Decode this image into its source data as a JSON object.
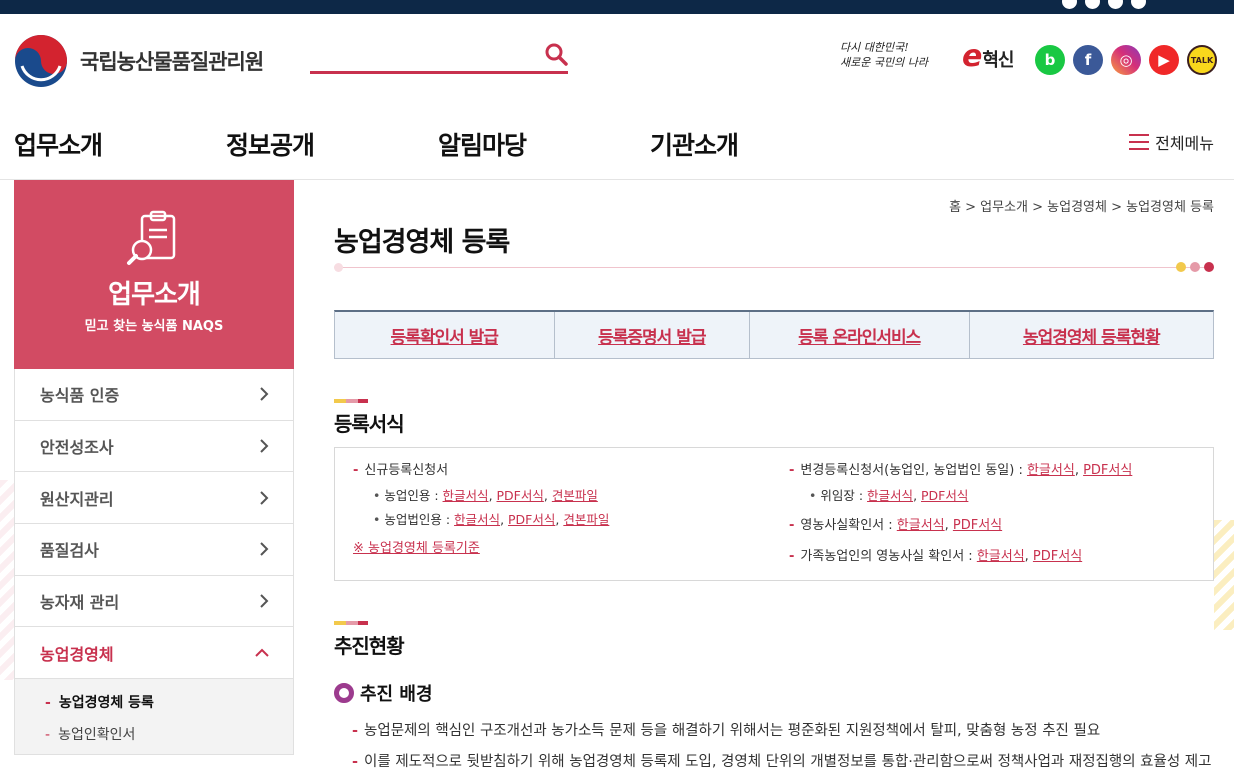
{
  "header": {
    "org_name": "국립농산물품질관리원",
    "search_placeholder": "",
    "slogan_line1": "다시 대한민국!",
    "slogan_line2": "새로운 국민의 나라",
    "innovation_e": "e",
    "innovation_text": "혁신",
    "sns": [
      {
        "icon": "blog-icon",
        "glyph": "b"
      },
      {
        "icon": "facebook-icon",
        "glyph": "f"
      },
      {
        "icon": "instagram-icon",
        "glyph": "◎"
      },
      {
        "icon": "youtube-icon",
        "glyph": "▶"
      },
      {
        "icon": "kakaotalk-icon",
        "glyph": "TALK"
      }
    ]
  },
  "gnb": {
    "menus": [
      "업무소개",
      "정보공개",
      "알림마당",
      "기관소개"
    ],
    "all_menu": "전체메뉴"
  },
  "lnb": {
    "title": "업무소개",
    "subtitle": "믿고 찾는 농식품 NAQS",
    "items": [
      "농식품 인증",
      "안전성조사",
      "원산지관리",
      "품질검사",
      "농자재 관리",
      "농업경영체"
    ],
    "sub_items": [
      "농업경영체 등록",
      "농업인확인서"
    ]
  },
  "content": {
    "breadcrumb": "홈 > 업무소개 > 농업경영체 > 농업경영체 등록",
    "title": "농업경영체 등록",
    "tabs": [
      "등록확인서 발급",
      "등록증명서 발급",
      "등록 온라인서비스",
      "농업경영체 등록현황"
    ],
    "section1": "등록서식",
    "forms": {
      "new_app": "신규등록신청서",
      "farmer_label": "농업인용 :",
      "corp_label": "농업법인용 :",
      "hangul": "한글서식",
      "pdf": "PDF서식",
      "sample": "견본파일",
      "standard_note": "※ 농업경영체 등록기준",
      "change_app": "변경등록신청서(농업인, 농업법인 동일) :",
      "delegation": "위임장 :",
      "farming_fact": "영농사실확인서 :",
      "family_fact": "가족농업인의 영농사실 확인서 :"
    },
    "section2": "추진현황",
    "background_title": "추진 배경",
    "para1": "농업문제의 핵심인 구조개선과 농가소득 문제 등을 해결하기 위해서는 평준화된 지원정책에서 탈피, 맞춤형 농정 추진 필요",
    "para2": "이를 제도적으로 뒷받침하기 위해 농업경영체 등록제 도입, 경영체 단위의 개별정보를 통합·관리함으로써 정책사업과 재정집행의 효율성 제고"
  },
  "colors": {
    "accent": "#c8314e",
    "lnb_bg": "#d24b63",
    "topbar": "#0d2847"
  }
}
